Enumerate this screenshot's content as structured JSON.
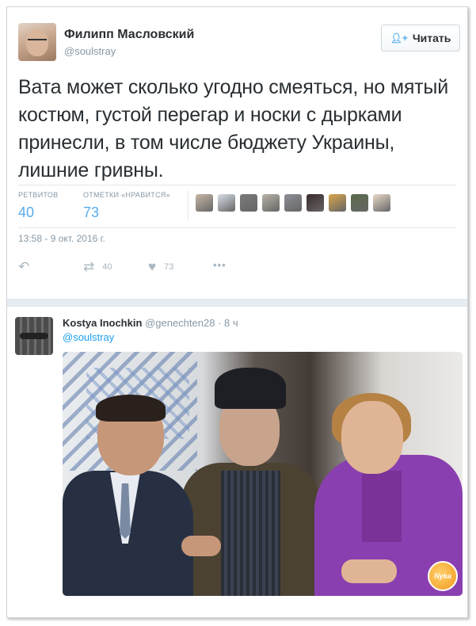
{
  "main_tweet": {
    "author_name": "Филипп Масловский",
    "author_handle": "@soulstray",
    "follow_label": "Читать",
    "text": "Вата может сколько угодно смеяться, но мятый костюм, густой перегар и носки с дырками принесли, в том числе бюджету Украины, лишние гривны.",
    "stats": {
      "retweets_label": "РЕТВИТОВ",
      "retweets_value": "40",
      "likes_label": "ОТМЕТКИ «НРАВИТСЯ»",
      "likes_value": "73"
    },
    "liker_colors": [
      "#c9b7a6",
      "#d7dfe6",
      "#7a7a7a",
      "#b9b3a8",
      "#8c8f96",
      "#3b2a2a",
      "#d9a64a",
      "#5a6b4a",
      "#e9d9c9"
    ],
    "timestamp": "13:58 - 9 окт. 2016 г.",
    "actions": {
      "retweet_count": "40",
      "like_count": "73",
      "more": "•••"
    },
    "icons": [
      "reply-icon",
      "retweet-icon",
      "heart-icon",
      "more-icon",
      "follow-user-icon"
    ]
  },
  "reply_tweet": {
    "author_name": "Kostya Inochkin",
    "author_handle": "@genechten28",
    "time": "· 8 ч",
    "reply_to": "@soulstray",
    "badge_text": "Nyka"
  },
  "colors": {
    "accent": "#55acee",
    "muted": "#8899a6",
    "text": "#292f33"
  }
}
